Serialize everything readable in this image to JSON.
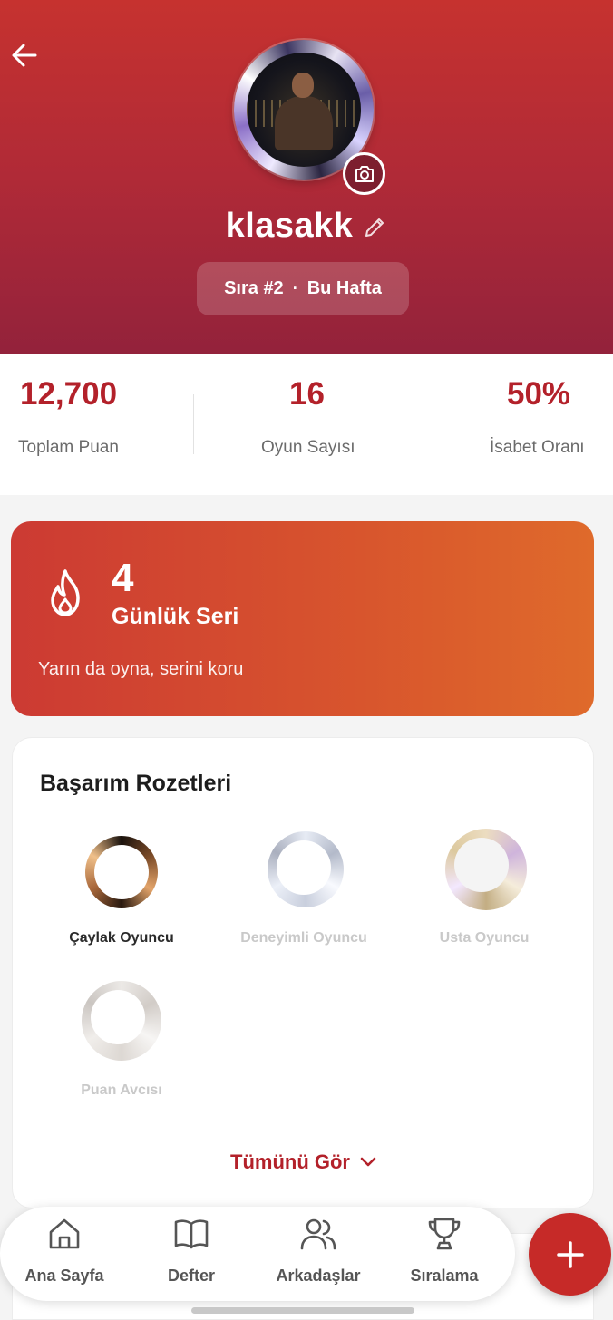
{
  "profile": {
    "username": "klasakk",
    "rank": "Sıra #2",
    "rank_separator": "·",
    "rank_period": "Bu Hafta"
  },
  "stats": [
    {
      "value": "12,700",
      "label": "Toplam Puan"
    },
    {
      "value": "16",
      "label": "Oyun Sayısı"
    },
    {
      "value": "50%",
      "label": "İsabet Oranı"
    }
  ],
  "streak": {
    "count": "4",
    "title": "Günlük Seri",
    "subtitle": "Yarın da oyna, serini koru"
  },
  "badges": {
    "title": "Başarım Rozetleri",
    "items": [
      {
        "label": "Çaylak Oyuncu",
        "unlocked": true
      },
      {
        "label": "Deneyimli Oyuncu",
        "unlocked": false
      },
      {
        "label": "Usta Oyuncu",
        "unlocked": false
      },
      {
        "label": "Puan Avcısı",
        "unlocked": false
      }
    ],
    "see_all": "Tümünü Gör"
  },
  "nav": {
    "items": [
      {
        "label": "Ana Sayfa",
        "icon": "home-icon"
      },
      {
        "label": "Defter",
        "icon": "book-icon"
      },
      {
        "label": "Arkadaşlar",
        "icon": "friends-icon"
      },
      {
        "label": "Sıralama",
        "icon": "trophy-icon"
      }
    ]
  },
  "colors": {
    "header_top": "#c6322f",
    "header_bottom": "#93223b",
    "accent": "#b3212a",
    "streak_start": "#cc3a33",
    "streak_end": "#df6a2b",
    "fab": "#c62a28"
  }
}
